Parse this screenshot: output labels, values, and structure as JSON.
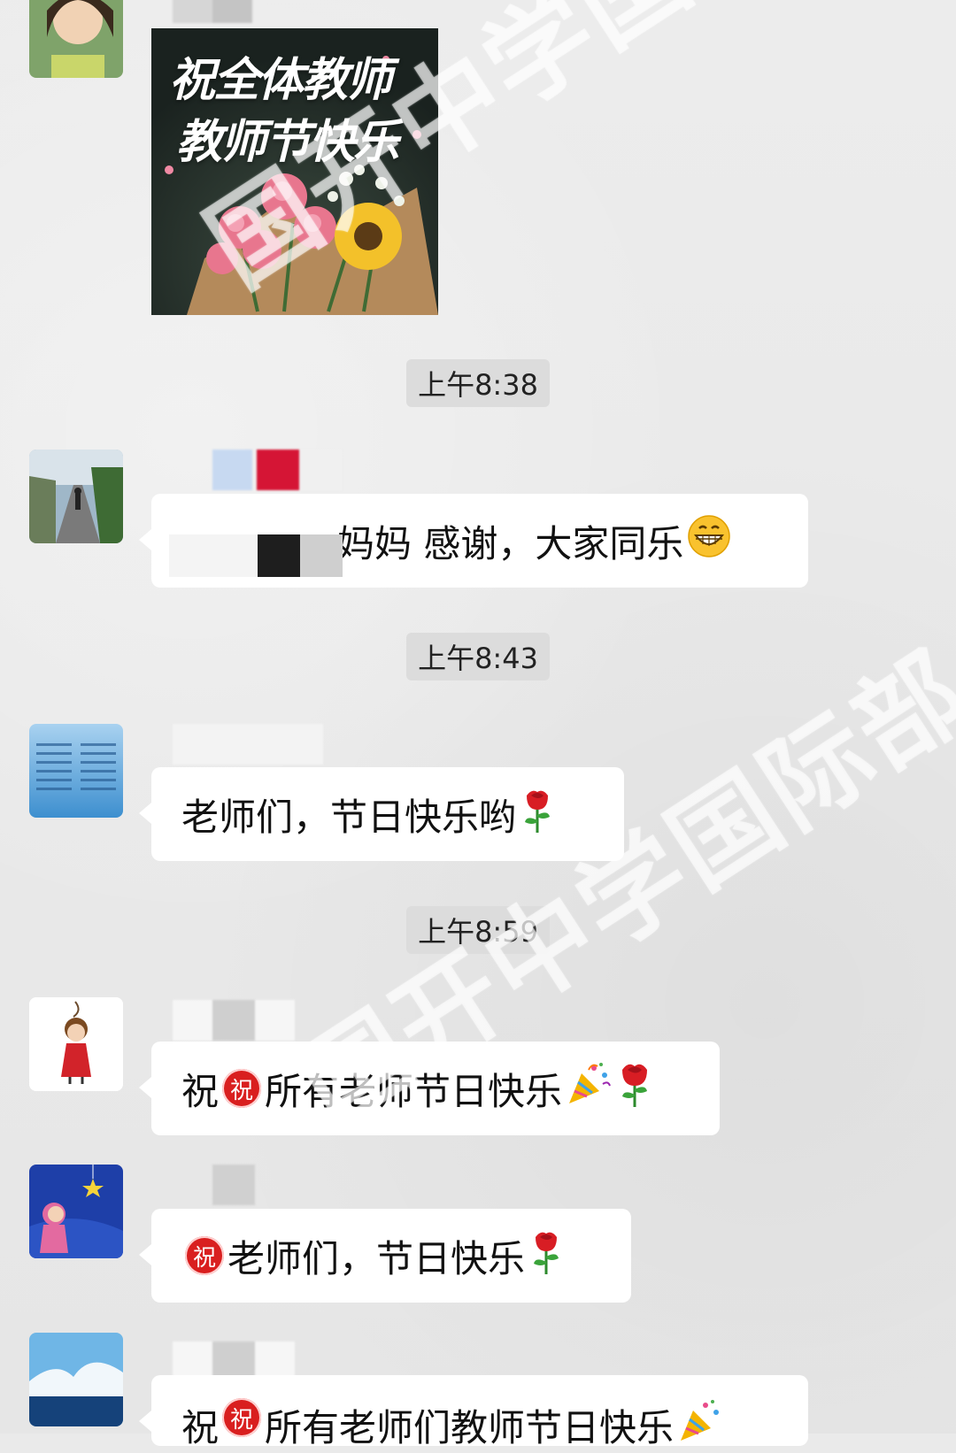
{
  "messages": {
    "image_card": {
      "line1": "祝全体教师",
      "line2": "教师节快乐"
    },
    "m1": {
      "text": "妈妈  感谢，大家同乐",
      "emoji": "grin-icon"
    },
    "m2": {
      "text": "老师们，节日快乐哟",
      "emoji": "rose-icon"
    },
    "m3": {
      "prefix": "祝",
      "badge": "祝",
      "text": "所有老师节日快乐",
      "emojis": [
        "party-popper-icon",
        "rose-icon"
      ]
    },
    "m4": {
      "badge": "祝",
      "text": "老师们，节日快乐",
      "emoji": "rose-icon"
    },
    "m5": {
      "prefix": "祝",
      "badge": "祝",
      "text": "所有老师们教师节日快乐",
      "emoji": "party-popper-icon"
    }
  },
  "timestamps": [
    "上午8:38",
    "上午8:43",
    "上午8:59"
  ],
  "watermark": "国开中学国际部",
  "colors": {
    "background": "#eaeaea",
    "bubble": "#ffffff",
    "badge_red": "#d91f1f"
  }
}
